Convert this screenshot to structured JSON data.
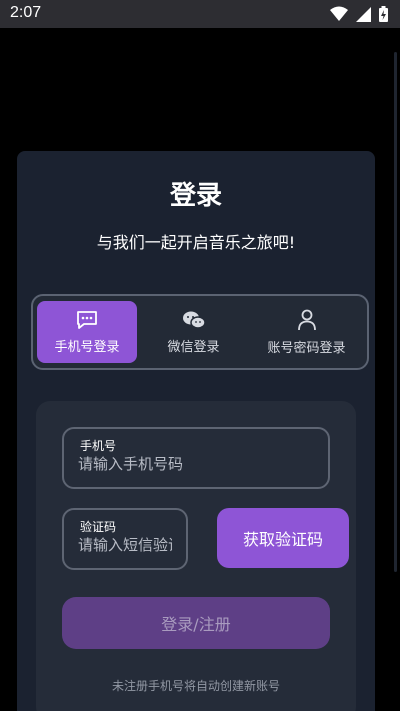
{
  "status_bar": {
    "time": "2:07",
    "icons": [
      "wifi-icon",
      "signal-icon",
      "battery-icon"
    ]
  },
  "login": {
    "title": "登录",
    "subtitle": "与我们一起开启音乐之旅吧!",
    "tabs": [
      {
        "label": "手机号登录",
        "icon": "message-icon",
        "active": true
      },
      {
        "label": "微信登录",
        "icon": "wechat-icon",
        "active": false
      },
      {
        "label": "账号密码登录",
        "icon": "user-icon",
        "active": false
      }
    ],
    "phone_field": {
      "label": "手机号",
      "placeholder": "请输入手机号码",
      "value": ""
    },
    "code_field": {
      "label": "验证码",
      "placeholder": "请输入短信验证码",
      "value": ""
    },
    "get_code_button": "获取验证码",
    "submit_button": "登录/注册",
    "hint": "未注册手机号将自动创建新账号"
  },
  "colors": {
    "accent": "#8e55d6",
    "background": "#000000",
    "card": "#1b2230",
    "panel": "#252c39",
    "disabled_button": "#5e3f86"
  }
}
